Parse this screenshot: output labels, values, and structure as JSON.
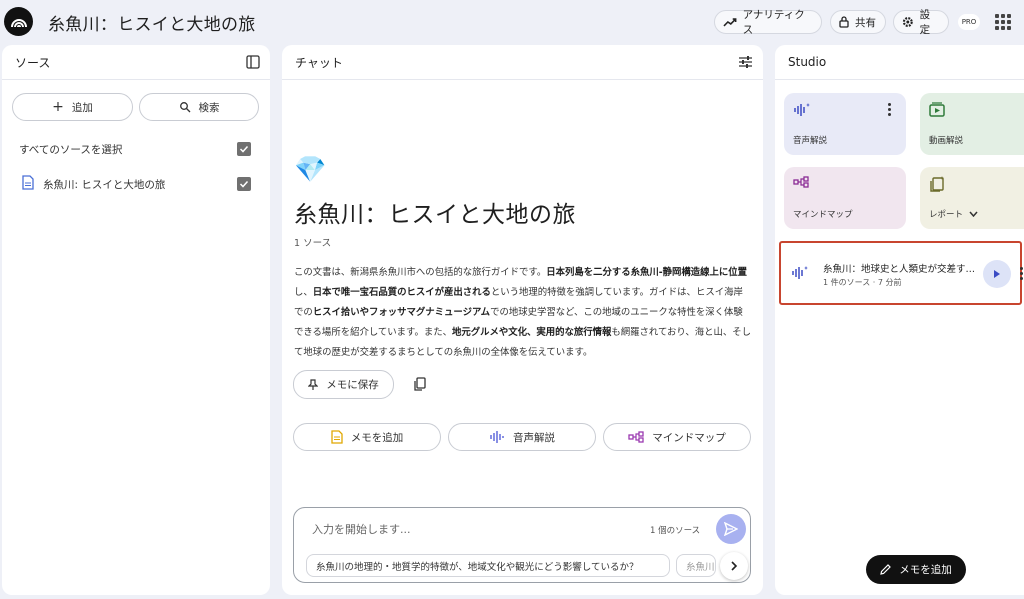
{
  "app": {
    "title": "糸魚川：ヒスイと大地の旅"
  },
  "topbar": {
    "analytics_label": "アナリティクス",
    "share_label": "共有",
    "settings_label": "設定",
    "pro_badge": "PRO"
  },
  "sources": {
    "header": "ソース",
    "add_label": "追加",
    "search_label": "検索",
    "select_all_label": "すべてのソースを選択",
    "items": [
      {
        "label": "糸魚川: ヒスイと大地の旅",
        "checked": true
      }
    ]
  },
  "chat": {
    "header": "チャット",
    "emoji": "💎",
    "title": "糸魚川：ヒスイと大地の旅",
    "source_count": "1 ソース",
    "summary": [
      {
        "text": "この文書は、新潟県糸魚川市への包括的な旅行ガイドです。",
        "bold": false
      },
      {
        "text": "日本列島を二分する糸魚川-静岡構造線上に位置",
        "bold": true
      },
      {
        "text": "し、",
        "bold": false
      },
      {
        "text": "日本で唯一宝石品質のヒスイが産出される",
        "bold": true
      },
      {
        "text": "という地理的特徴を強調しています。ガイドは、ヒスイ海岸での",
        "bold": false
      },
      {
        "text": "ヒスイ拾いやフォッサマグナミュージアム",
        "bold": true
      },
      {
        "text": "での地球史学習など、この地域のユニークな特性を深く体験できる場所を紹介しています。また、",
        "bold": false
      },
      {
        "text": "地元グルメや文化、実用的な旅行情報",
        "bold": true
      },
      {
        "text": "も網羅されており、海と山、そして地球の歴史が交差するまちとしての糸魚川の全体像を伝えています。",
        "bold": false
      }
    ],
    "save_memo_label": "メモに保存",
    "actions": {
      "add_memo": "メモを追加",
      "audio_overview": "音声解説",
      "mind_map": "マインドマップ"
    },
    "composer": {
      "placeholder": "入力を開始します...",
      "source_count": "1 個のソース"
    },
    "suggestions": [
      "糸魚川の地理的・地質学的特徴が、地域文化や観光にどう影響しているか？",
      "糸魚川"
    ]
  },
  "studio": {
    "header": "Studio",
    "cards": {
      "audio": "音声解説",
      "video": "動画解説",
      "mindmap": "マインドマップ",
      "report": "レポート"
    },
    "colors": {
      "audio": "#e8eaf7",
      "video": "#e3efe4",
      "mindmap": "#f1e6ef",
      "report": "#f1f0e3"
    },
    "audio_item": {
      "title": "糸魚川：地球史と人類史が交差するまち",
      "meta": "1 件のソース · 7 分前"
    },
    "add_memo_label": "メモを追加"
  }
}
